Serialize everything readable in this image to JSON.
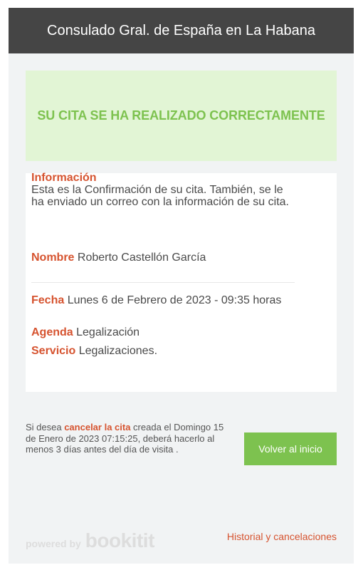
{
  "header": {
    "title": "Consulado Gral. de España en La Habana"
  },
  "success_banner": {
    "message": "SU CITA SE HA REALIZADO CORRECTAMENTE"
  },
  "info": {
    "label": "Información",
    "text": "Esta es la Confirmación de su cita. También, se le ha enviado un correo con la información de su cita."
  },
  "details": {
    "nombre_label": "Nombre",
    "nombre_value": "Roberto Castellón García",
    "fecha_label": "Fecha",
    "fecha_value": "Lunes 6 de Febrero de 2023 - 09:35 horas",
    "agenda_label": "Agenda",
    "agenda_value": "Legalización",
    "servicio_label": "Servicio",
    "servicio_value": "Legalizaciones."
  },
  "cancel": {
    "prefix": "Si desea ",
    "link": "cancelar la cita",
    "suffix": " creada el Domingo 15 de Enero de 2023 07:15:25, deberá hacerlo al menos 3 días antes del día de visita ."
  },
  "button": {
    "label": "Volver al inicio"
  },
  "footer": {
    "powered_by": "powered by",
    "brand": "bookitit",
    "history_link": "Historial y cancelaciones"
  },
  "colors": {
    "header_bg": "#454545",
    "accent_green": "#7dc24f",
    "label_orange": "#d6532f",
    "success_bg": "#e2f5d5"
  }
}
